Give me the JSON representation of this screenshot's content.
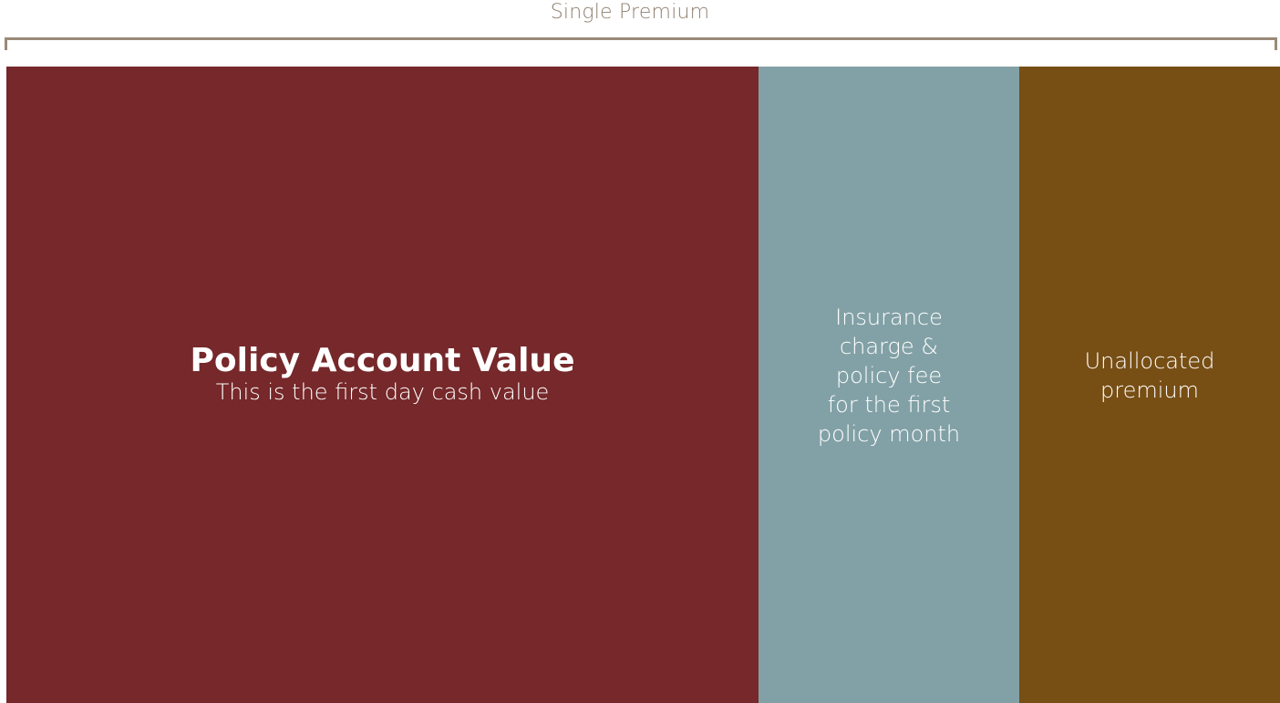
{
  "header": {
    "label": "Single Premium",
    "label_color": "#8e7f6e",
    "bracket_color": "#9a8a78"
  },
  "blocks": {
    "policy_account_value": {
      "title": "Policy Account Value",
      "subtitle": "This is the first day cash value",
      "color": "#76282a"
    },
    "insurance_charge": {
      "lines": [
        "Insurance",
        "charge &",
        "policy fee",
        "for the first",
        "policy month"
      ],
      "color": "#82a1a6"
    },
    "unallocated_premium": {
      "lines": [
        "Unallocated",
        "premium"
      ],
      "color": "#774e14"
    }
  }
}
